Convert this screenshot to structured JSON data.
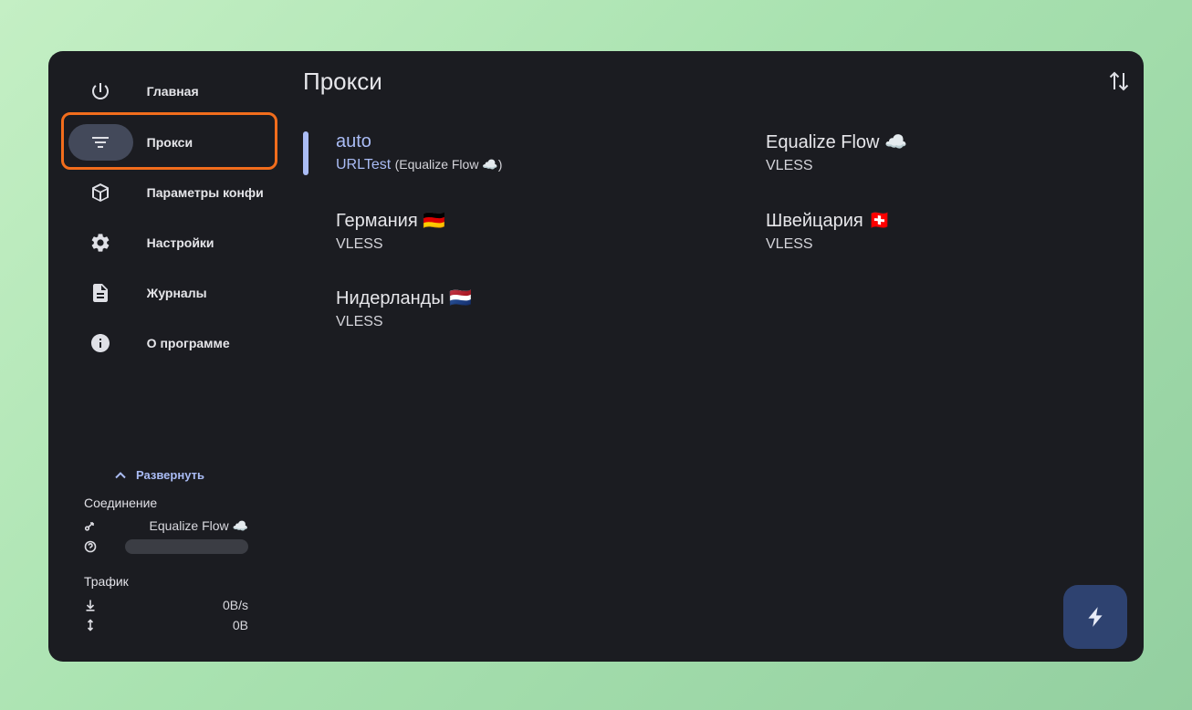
{
  "sidebar": {
    "items": [
      {
        "label": "Главная",
        "icon": "power-icon"
      },
      {
        "label": "Прокси",
        "icon": "filter-icon",
        "active": true
      },
      {
        "label": "Параметры конфи",
        "icon": "package-icon"
      },
      {
        "label": "Настройки",
        "icon": "gear-icon"
      },
      {
        "label": "Журналы",
        "icon": "document-icon"
      },
      {
        "label": "О программе",
        "icon": "info-icon"
      }
    ],
    "expand_label": "Развернуть",
    "connection": {
      "title": "Соединение",
      "proxy": "Equalize Flow ☁️"
    },
    "traffic": {
      "title": "Трафик",
      "speed": "0B/s",
      "total": "0B"
    }
  },
  "main": {
    "title": "Прокси",
    "proxies": [
      {
        "name": "auto",
        "type": "URLTest",
        "sub": "(Equalize Flow ☁️)",
        "selected": true
      },
      {
        "name": "Equalize Flow ☁️",
        "type": "VLESS"
      },
      {
        "name": "Германия 🇩🇪",
        "type": "VLESS"
      },
      {
        "name": "Швейцария 🇨🇭",
        "type": "VLESS"
      },
      {
        "name": "Нидерланды 🇳🇱",
        "type": "VLESS"
      }
    ]
  },
  "colors": {
    "accent": "#aabcf5",
    "highlight": "#f26d1c",
    "background": "#1b1c21",
    "fab": "#2e4270"
  }
}
